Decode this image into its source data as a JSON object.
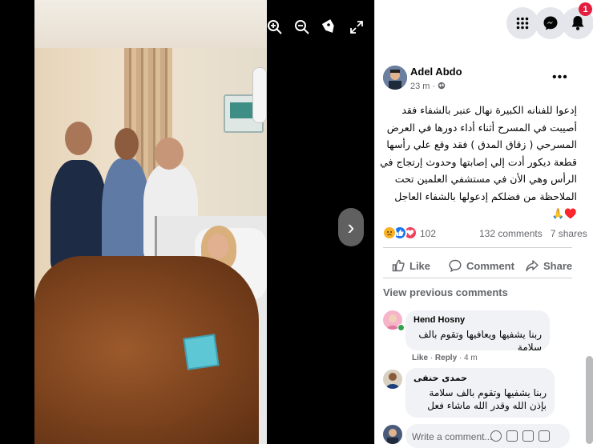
{
  "viewer": {
    "zoom_in": "zoom-in-icon",
    "zoom_out": "zoom-out-icon",
    "tag": "tag-icon",
    "fullscreen": "fullscreen-icon",
    "next": "›"
  },
  "topbar": {
    "notification_count": "1"
  },
  "post": {
    "author": "Adel Abdo",
    "time": "23 m ·",
    "more": "•••",
    "text": "إدعوا للفنانه الكبيرة نهال عنبر بالشفاء فقد أصيبت في المسرح أثناء أداء دورها في العرض المسرحي ( زقاق المدق ) فقد وقع علي رأسها قطعة ديكور أدت إلي إصابتها وحدوث إرتجاج في الرأس وهي الأن في مستشفي العلمين تحت الملاحظة من فضلكم إدعولها بالشفاء العاجل ♥️🙏",
    "reaction_count": "102",
    "comments": "132 comments",
    "shares": "7 shares"
  },
  "actions": {
    "like": "Like",
    "comment": "Comment",
    "share": "Share"
  },
  "view_previous": "View previous comments",
  "comments": [
    {
      "name": "Hend Hosny",
      "text": "ربنا يشفيها ويعافيها وتقوم بالف سلامة",
      "like": "Like",
      "reply": "Reply",
      "time": "· 4 m"
    },
    {
      "name": "حمدى حنفى",
      "text": "ربنا يشفيها وتقوم بالف سلامة بإذن الله وقدر الله ماشاء فعل"
    }
  ],
  "write_comment": {
    "placeholder": "Write a comment..."
  },
  "colors": {
    "accent": "#1877f2",
    "badge": "#e41e3f",
    "heart": "#f33e58",
    "like": "#1877f2",
    "sad": "#f7b125"
  }
}
